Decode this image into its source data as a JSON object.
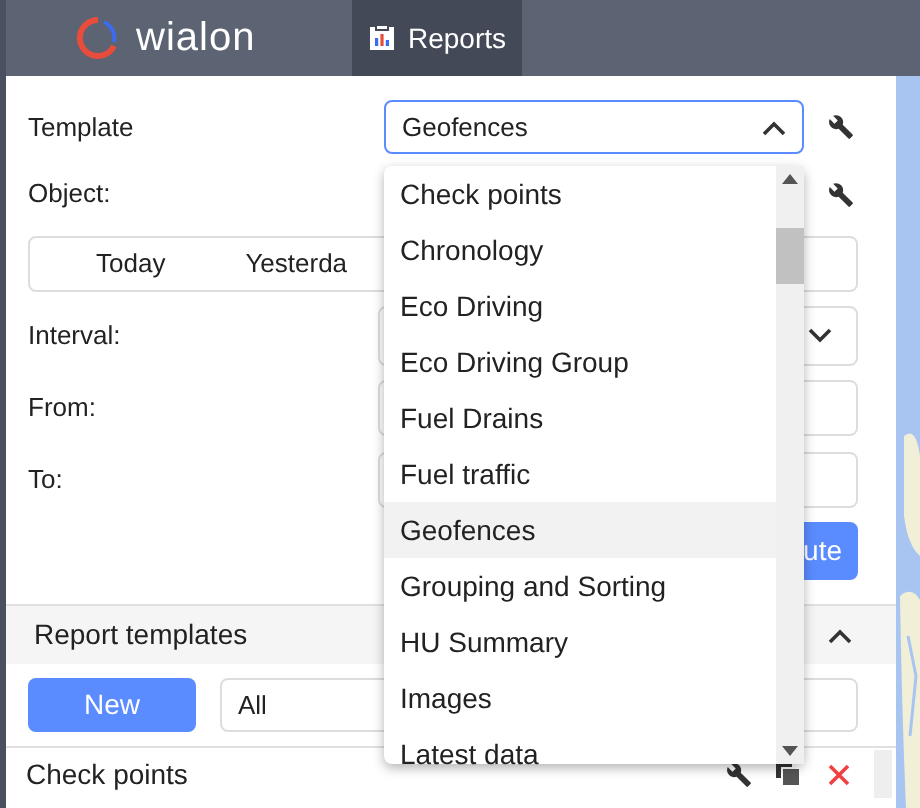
{
  "header": {
    "logo": "wialon",
    "tabs": [
      {
        "label": "Reports",
        "selected": true
      }
    ]
  },
  "form": {
    "template_label": "Template",
    "template_value": "Geofences",
    "template_expanded": true,
    "object_label": "Object:",
    "periods": [
      {
        "label": "Today",
        "selected": false
      },
      {
        "label": "Yesterda",
        "selected": false
      }
    ],
    "interval_label": "Interval:",
    "from_label": "From:",
    "to_label": "To:",
    "execute_button": "ute"
  },
  "dropdown": {
    "items": [
      {
        "label": "Check points",
        "selected": false
      },
      {
        "label": "Chronology",
        "selected": false
      },
      {
        "label": "Eco Driving",
        "selected": false
      },
      {
        "label": "Eco Driving Group",
        "selected": false
      },
      {
        "label": "Fuel Drains",
        "selected": false
      },
      {
        "label": "Fuel traffic",
        "selected": false
      },
      {
        "label": "Geofences",
        "selected": true
      },
      {
        "label": "Grouping and Sorting",
        "selected": false
      },
      {
        "label": "HU Summary",
        "selected": false
      },
      {
        "label": "Images",
        "selected": false
      },
      {
        "label": "Latest data",
        "selected": false
      }
    ]
  },
  "report_templates": {
    "title": "Report templates",
    "expanded": true,
    "new_button": "New",
    "filter_value": "All",
    "rows": [
      {
        "name": "Check points"
      }
    ]
  }
}
